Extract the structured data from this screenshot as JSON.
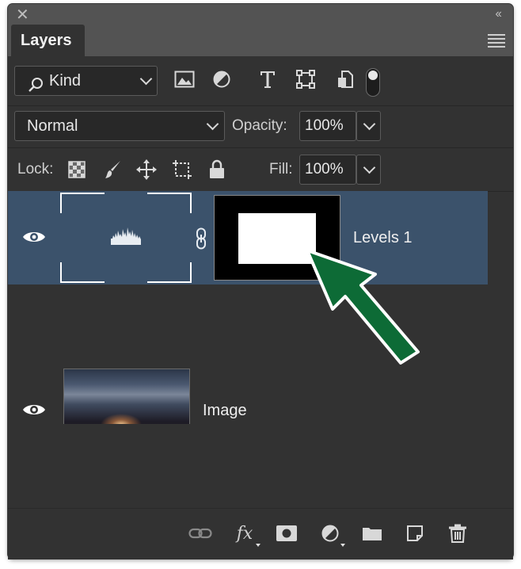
{
  "panel": {
    "tab_title": "Layers"
  },
  "filter": {
    "kind_label": "Kind"
  },
  "blend": {
    "mode": "Normal",
    "opacity_label": "Opacity:",
    "opacity_value": "100%"
  },
  "lock": {
    "label": "Lock:",
    "fill_label": "Fill:",
    "fill_value": "100%"
  },
  "layers": [
    {
      "name": "Levels 1",
      "type": "adjustment",
      "selected": true
    },
    {
      "name": "Image",
      "type": "pixel",
      "selected": false
    }
  ],
  "colors": {
    "panel_bg": "#323232",
    "selected_row": "#3b526b",
    "annotation_arrow": "#0d6b36"
  }
}
